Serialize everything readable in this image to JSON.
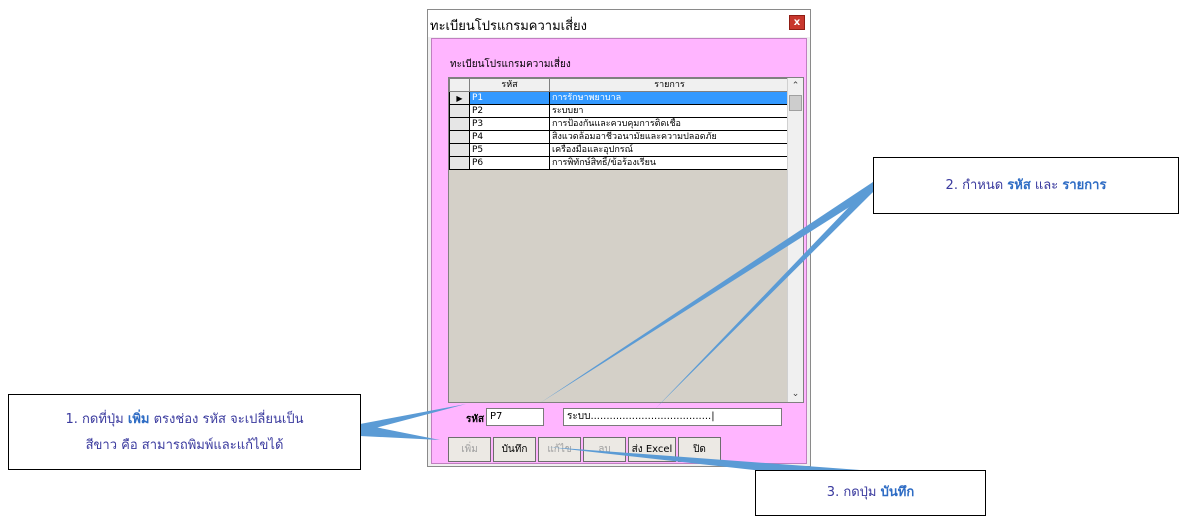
{
  "window": {
    "title": "ทะเบียนโปรแกรมความเสี่ยง",
    "close_glyph": "x"
  },
  "form": {
    "section_title": "ทะเบียนโปรแกรมความเสี่ยง"
  },
  "grid": {
    "columns": [
      "รหัส",
      "รายการ"
    ],
    "row_marker": "▶",
    "rows": [
      {
        "code": "P1",
        "name": "การรักษาพยาบาล"
      },
      {
        "code": "P2",
        "name": "ระบบยา"
      },
      {
        "code": "P3",
        "name": "การป้องกันและควบคุมการติดเชื้อ"
      },
      {
        "code": "P4",
        "name": "สิ่งแวดล้อมอาชีวอนามัยและความปลอดภัย"
      },
      {
        "code": "P5",
        "name": "เครื่องมือและอุปกรณ์"
      },
      {
        "code": "P6",
        "name": "การพิทักษ์สิทธิ์/ข้อร้องเรียน"
      }
    ]
  },
  "input": {
    "code_label": "รหัส",
    "code_value": "P7",
    "name_value": "ระบบ......................................|"
  },
  "buttons": {
    "add": "เพิ่ม",
    "save": "บันทึก",
    "edit": "แก้ไข",
    "delete": "ลบ",
    "export": "ส่ง Excel",
    "close": "ปิด"
  },
  "callouts": {
    "c1_line1_a": "1. กดที่ปุ่ม ",
    "c1_line1_b": "เพิ่ม",
    "c1_line1_c": " ตรงช่อง รหัส จะเปลี่ยนเป็น",
    "c1_line2": "สีขาว คือ สามารถพิมพ์และแก้ไขได้",
    "c2_a": "2. กำหนด ",
    "c2_b": "รหัส",
    "c2_c": " และ ",
    "c2_d": "รายการ",
    "c3_a": "3. กดปุ่ม ",
    "c3_b": "บันทึก"
  },
  "colors": {
    "form_bg": "#ffb5ff",
    "selection": "#3399ff",
    "pointer": "#5b9bd5"
  }
}
